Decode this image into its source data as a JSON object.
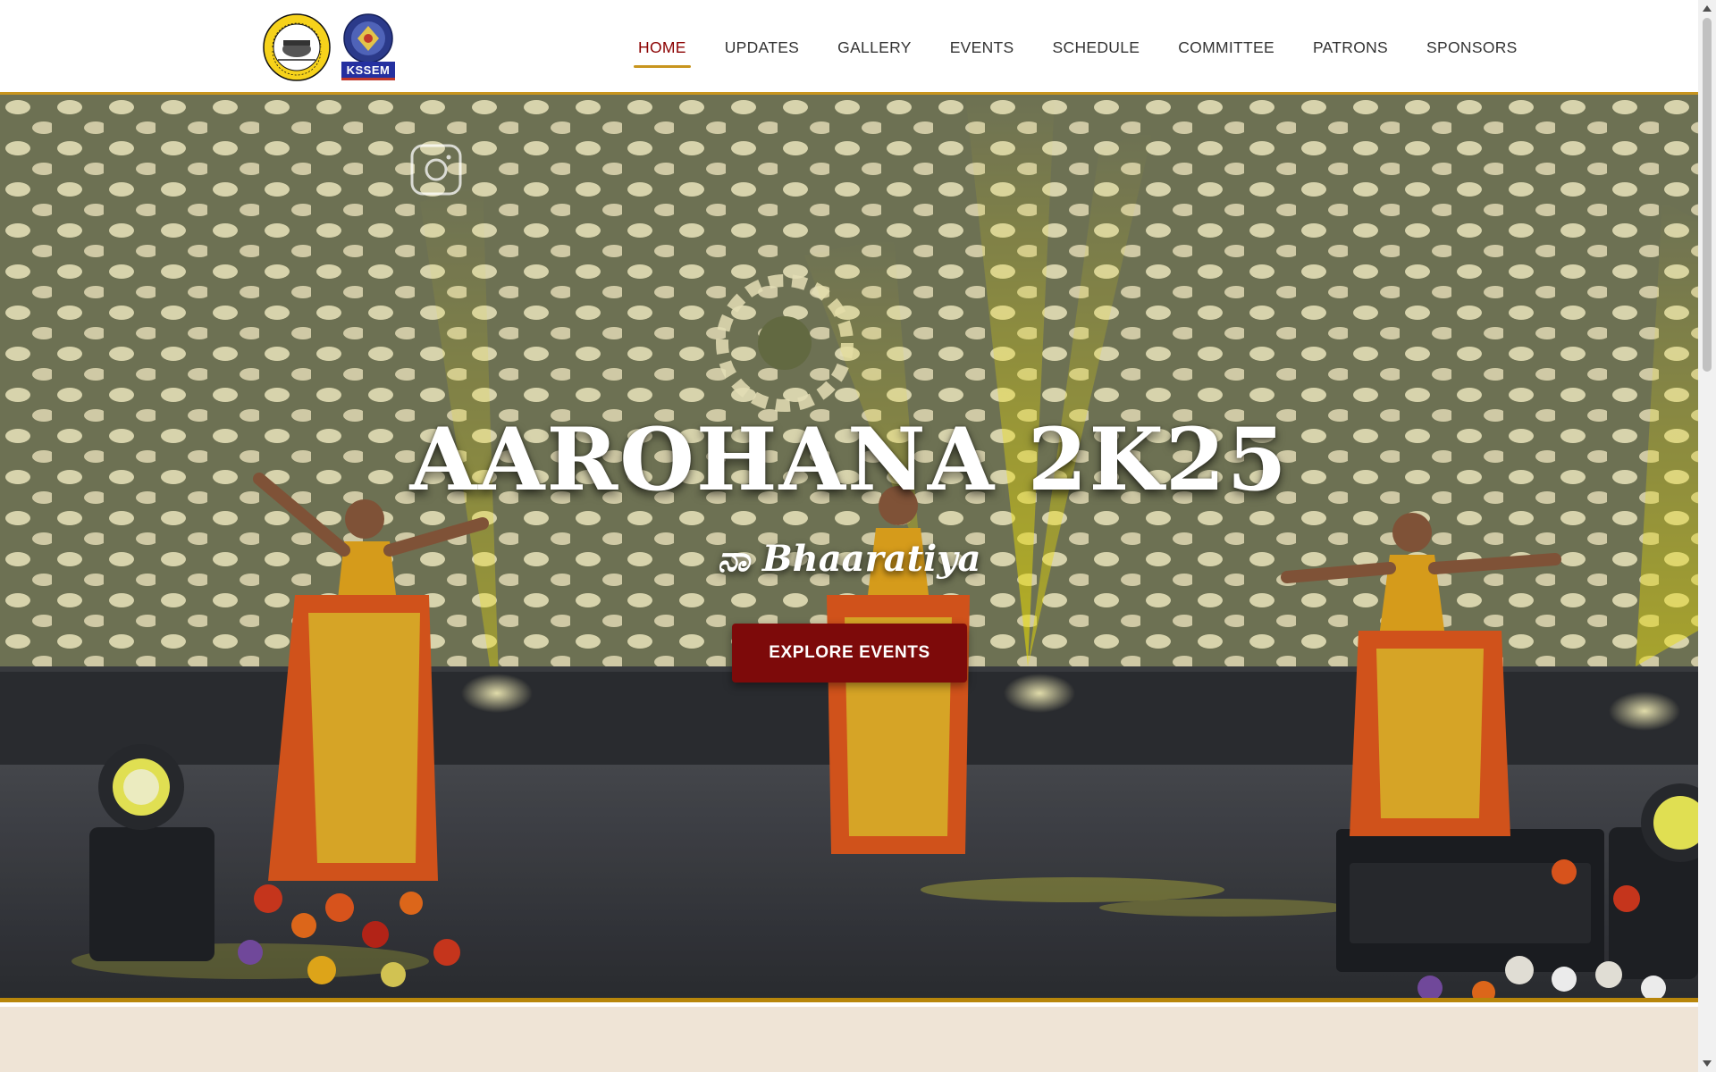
{
  "header": {
    "logos": [
      {
        "name": "institution-seal"
      },
      {
        "name": "kssem-logo",
        "text": "KSSEM"
      }
    ],
    "nav": [
      {
        "label": "HOME",
        "active": true
      },
      {
        "label": "UPDATES",
        "active": false
      },
      {
        "label": "GALLERY",
        "active": false
      },
      {
        "label": "EVENTS",
        "active": false
      },
      {
        "label": "SCHEDULE",
        "active": false
      },
      {
        "label": "COMMITTEE",
        "active": false
      },
      {
        "label": "PATRONS",
        "active": false
      },
      {
        "label": "SPONSORS",
        "active": false
      }
    ]
  },
  "hero": {
    "title": "AAROHANA 2K25",
    "subtitle": "ನಾ Bhaaratiya",
    "cta_label": "EXPLORE EVENTS",
    "background": "stage-dance-performance",
    "overlay_icon": "instagram-icon"
  },
  "colors": {
    "accent": "#8b0000",
    "cta": "#7d0a0a",
    "gold": "#c8951e",
    "band": "#efe4d6"
  }
}
